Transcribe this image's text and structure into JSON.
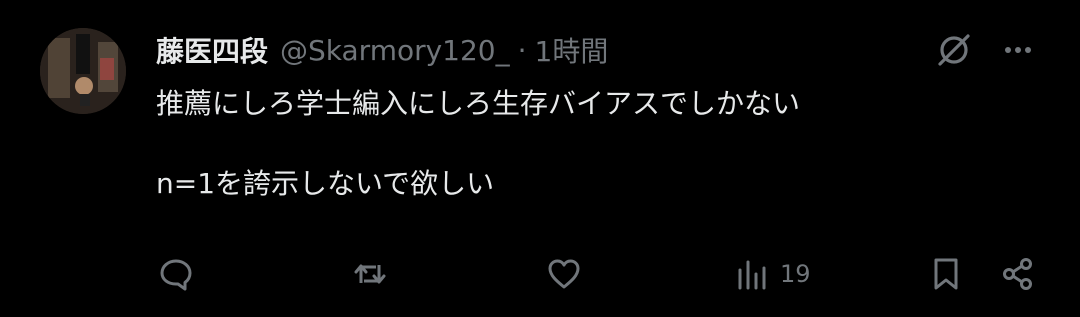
{
  "tweet": {
    "display_name": "藤医四段",
    "handle": "@Skarmory120_",
    "separator": "·",
    "time": "1時間",
    "text_lines": [
      "推薦にしろ学士編入にしろ生存バイアスでしかない",
      "",
      "n=1を誇示しないで欲しい"
    ],
    "header_icons": {
      "grok": "grok-icon",
      "more": "more-icon"
    },
    "actions": {
      "reply": {
        "icon": "reply-icon"
      },
      "retweet": {
        "icon": "retweet-icon"
      },
      "like": {
        "icon": "like-icon"
      },
      "views": {
        "icon": "views-icon",
        "count": "19"
      },
      "bookmark": {
        "icon": "bookmark-icon"
      },
      "share": {
        "icon": "share-icon"
      }
    }
  },
  "colors": {
    "background": "#000000",
    "text_primary": "#e7e9ea",
    "text_secondary": "#71767b"
  }
}
